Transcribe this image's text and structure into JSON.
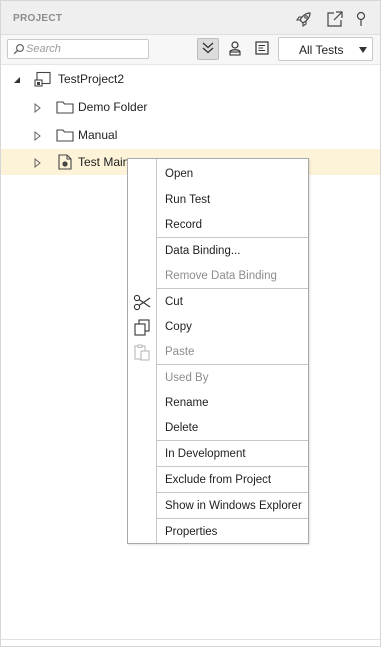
{
  "panel": {
    "title": "PROJECT",
    "title_icons": [
      "rocket-icon",
      "open-external-icon",
      "pin-icon"
    ]
  },
  "toolbar": {
    "search_placeholder": "Search",
    "search_value": "",
    "buttons": [
      "collapse-all-icon",
      "user-filter-icon",
      "list-view-icon"
    ],
    "filter_selected": "All Tests"
  },
  "tree": {
    "root": {
      "label": "TestProject2",
      "expanded": true
    },
    "children": [
      {
        "label": "Demo Folder",
        "icon": "folder-icon"
      },
      {
        "label": "Manual",
        "icon": "folder-icon"
      },
      {
        "label": "Test Main",
        "icon": "test-file-icon",
        "selected": true
      }
    ]
  },
  "context_menu": {
    "items": [
      {
        "label": "Open",
        "enabled": true
      },
      {
        "label": "Run Test",
        "enabled": true
      },
      {
        "label": "Record",
        "enabled": true
      },
      {
        "label": "Data Binding...",
        "enabled": true
      },
      {
        "label": "Remove Data Binding",
        "enabled": false
      },
      {
        "label": "Cut",
        "enabled": true,
        "icon": "scissors-icon"
      },
      {
        "label": "Copy",
        "enabled": true,
        "icon": "copy-icon"
      },
      {
        "label": "Paste",
        "enabled": false,
        "icon": "paste-icon"
      },
      {
        "label": "Used By",
        "enabled": false
      },
      {
        "label": "Rename",
        "enabled": true
      },
      {
        "label": "Delete",
        "enabled": true
      },
      {
        "label": "In Development",
        "enabled": true
      },
      {
        "label": "Exclude from Project",
        "enabled": true
      },
      {
        "label": "Show in Windows Explorer",
        "enabled": true
      },
      {
        "label": "Properties",
        "enabled": true
      }
    ]
  },
  "colors": {
    "selection": "#fdf3d9",
    "disabled_text": "#8d8d8d",
    "header_bg": "#efefef"
  }
}
